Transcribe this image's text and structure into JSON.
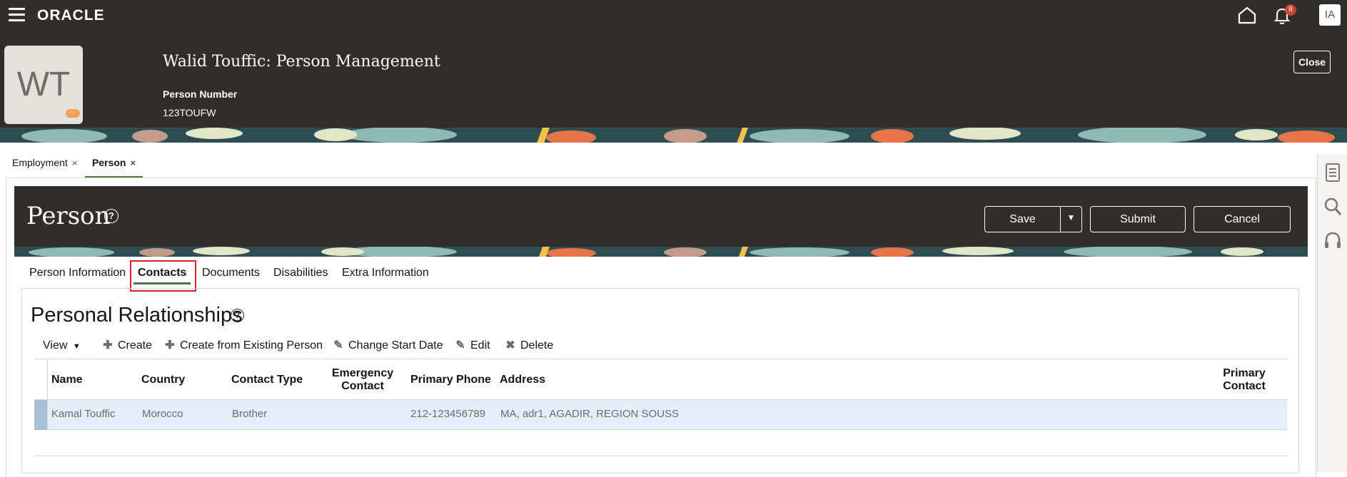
{
  "brand": {
    "logo_text": "ORACLE"
  },
  "notifications": {
    "count": "8"
  },
  "user": {
    "initials": "IA"
  },
  "person_header": {
    "photo_initials": "WT",
    "photo_badge": "···",
    "title": "Walid Touffic: Person Management",
    "number_label": "Person Number",
    "number_value": "123TOUFW",
    "close_label": "Close"
  },
  "dynamic_tabs": [
    {
      "label": "Employment",
      "close": "×"
    },
    {
      "label": "Person",
      "close": "×"
    }
  ],
  "page": {
    "title": "Person",
    "help": "?",
    "save_label": "Save",
    "save_dropdown": "▼",
    "submit_label": "Submit",
    "cancel_label": "Cancel"
  },
  "subtabs": [
    {
      "label": "Person Information"
    },
    {
      "label": "Contacts"
    },
    {
      "label": "Documents"
    },
    {
      "label": "Disabilities"
    },
    {
      "label": "Extra Information"
    }
  ],
  "section": {
    "title": "Personal Relationships",
    "help": "?"
  },
  "toolbar": {
    "view": "View",
    "view_caret": "▼",
    "create": "Create",
    "create_existing": "Create from Existing Person",
    "change_start_date": "Change Start Date",
    "edit": "Edit",
    "delete": "Delete"
  },
  "table": {
    "columns": {
      "name": "Name",
      "country": "Country",
      "contact_type": "Contact Type",
      "emergency_1": "Emergency",
      "emergency_2": "Contact",
      "primary_phone": "Primary Phone",
      "address": "Address",
      "primary_1": "Primary",
      "primary_2": "Contact"
    },
    "rows": [
      {
        "name": "Kamal Touffic",
        "country": "Morocco",
        "contact_type": "Brother",
        "emergency_contact": "",
        "primary_phone": "212-123456789",
        "address": "MA, adr1, AGADIR, REGION SOUSS",
        "primary_contact": ""
      }
    ]
  },
  "colors": {
    "header_bg": "#312d2a",
    "accent_green": "#4b7a47",
    "selected_row": "#e2eefa",
    "highlight_red": "#e01f2e",
    "badge_red": "#c74634"
  }
}
